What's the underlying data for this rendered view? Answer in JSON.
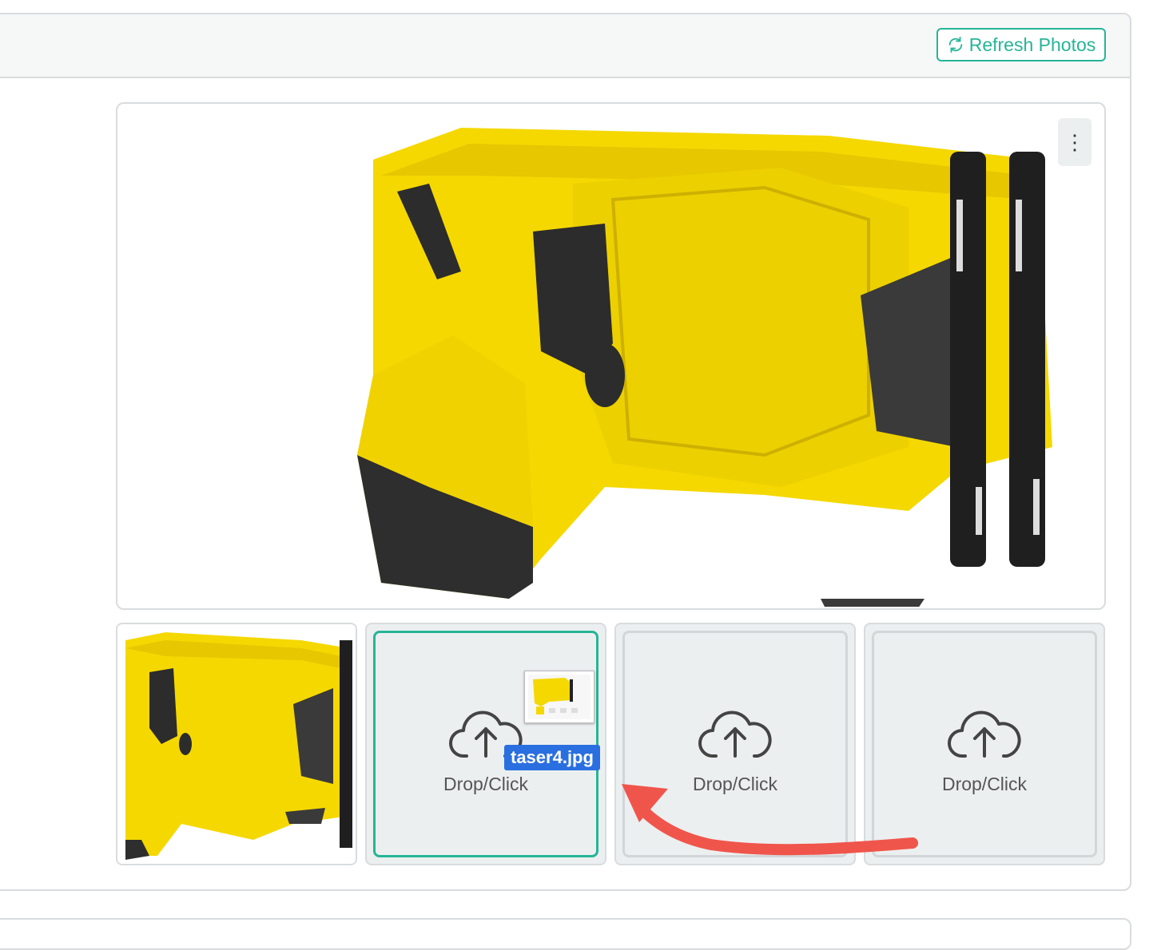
{
  "header": {
    "refresh_label": "Refresh Photos",
    "refresh_icon": "refresh-icon"
  },
  "main_photo": {
    "menu_icon": "kebab-icon",
    "menu_label": "⋮"
  },
  "thumbnails": {
    "slot_2_label": "Drop/Click",
    "slot_3_label": "Drop/Click",
    "slot_4_label": "Drop/Click",
    "upload_icon": "cloud-upload-icon"
  },
  "drag": {
    "file_name": "taser4.jpg"
  },
  "colors": {
    "accent": "#25b596",
    "drag_tag": "#2a6fe0",
    "arrow": "#f0554b",
    "taser_yellow": "#f5d800"
  }
}
